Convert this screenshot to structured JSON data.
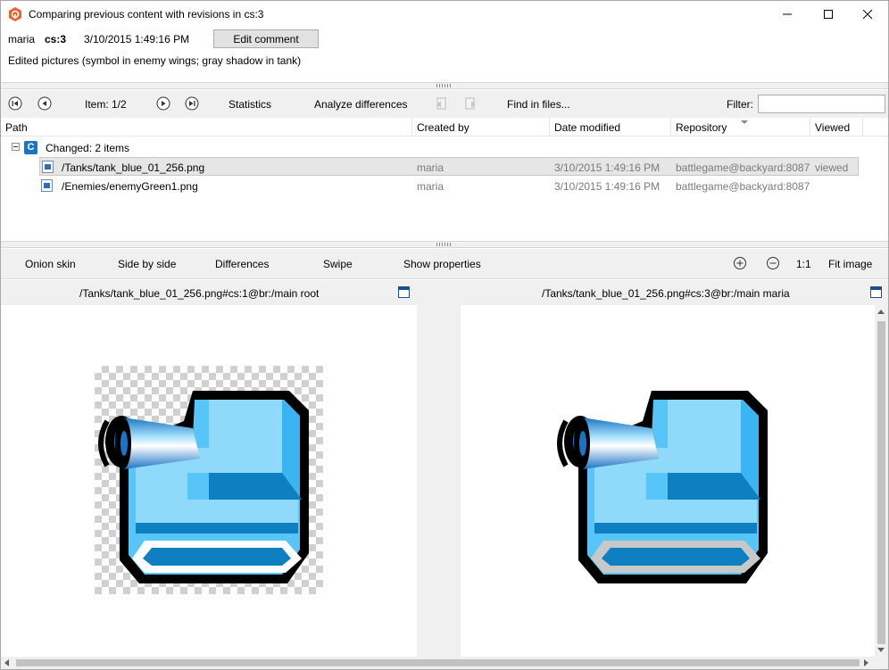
{
  "window": {
    "title": "Comparing previous content with revisions in cs:3"
  },
  "changeset": {
    "user": "maria",
    "cs": "cs:3",
    "date": "3/10/2015 1:49:16 PM",
    "edit_button": "Edit comment",
    "comment": "Edited pictures (symbol in enemy wings; gray shadow in tank)"
  },
  "nav": {
    "item_counter": "Item: 1/2",
    "statistics": "Statistics",
    "analyze": "Analyze differences",
    "find": "Find in files...",
    "filter_label": "Filter:",
    "filter_value": ""
  },
  "table": {
    "columns": [
      "Path",
      "Created by",
      "Date modified",
      "Repository",
      "Viewed"
    ],
    "group_badge": "C",
    "group_label": "Changed: 2 items",
    "rows": [
      {
        "path": "/Tanks/tank_blue_01_256.png",
        "created_by": "maria",
        "date": "3/10/2015 1:49:16 PM",
        "repository": "battlegame@backyard:8087",
        "viewed": "viewed"
      },
      {
        "path": "/Enemies/enemyGreen1.png",
        "created_by": "maria",
        "date": "3/10/2015 1:49:16 PM",
        "repository": "battlegame@backyard:8087",
        "viewed": ""
      }
    ]
  },
  "diff_toolbar": {
    "onion": "Onion skin",
    "side": "Side by side",
    "differences": "Differences",
    "swipe": "Swipe",
    "properties": "Show properties",
    "ratio": "1:1",
    "fit": "Fit image"
  },
  "panels": {
    "left_title": "/Tanks/tank_blue_01_256.png#cs:1@br:/main root",
    "right_title": "/Tanks/tank_blue_01_256.png#cs:3@br:/main maria"
  },
  "colors": {
    "accent": "#1976c6",
    "tank_light": "#8fd9fb",
    "tank_mid": "#3ab4f2",
    "tank_dark": "#0e7fc1",
    "shadow_left": "#ffffff",
    "shadow_right": "#c8c8c8"
  }
}
